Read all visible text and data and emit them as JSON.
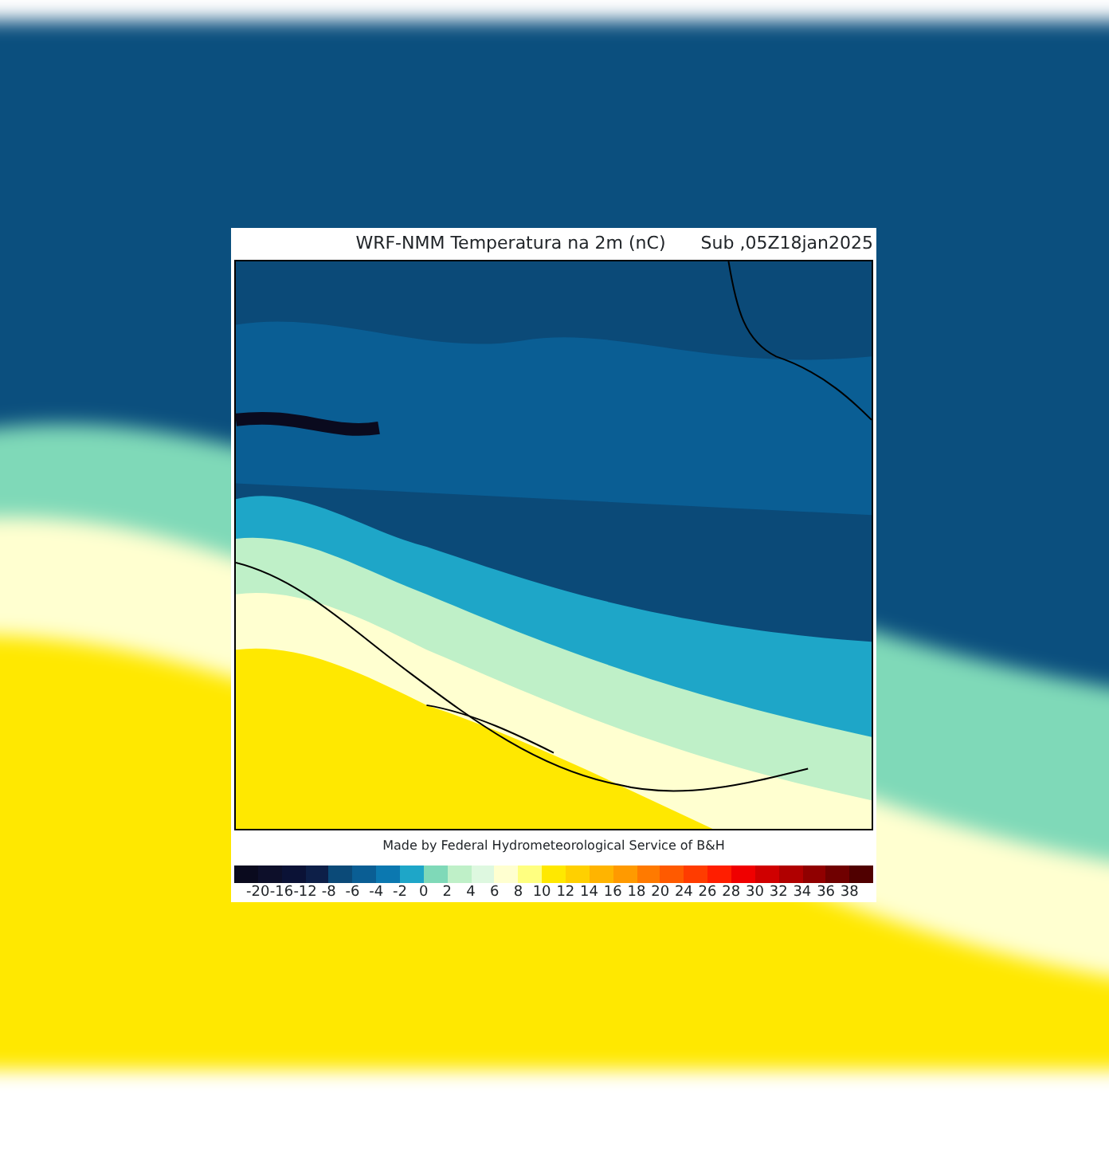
{
  "title": "WRF-NMM Temperatura na 2m (nC)",
  "valid_time": "Sub ,05Z18jan2025",
  "credit": "Made by Federal Hydrometeorological Service of B&H",
  "legend": {
    "bins": [
      {
        "color": "#0a0a1e"
      },
      {
        "color": "#0d0f2a"
      },
      {
        "color": "#0b1236"
      },
      {
        "color": "#0d1f48"
      },
      {
        "color": "#0b4a78"
      },
      {
        "color": "#0a5e94"
      },
      {
        "color": "#0b78b0"
      },
      {
        "color": "#1ea6c8"
      },
      {
        "color": "#7fd9b8"
      },
      {
        "color": "#bff0c8"
      },
      {
        "color": "#def8e0"
      },
      {
        "color": "#ffffd0"
      },
      {
        "color": "#ffff80"
      },
      {
        "color": "#ffe800"
      },
      {
        "color": "#ffd000"
      },
      {
        "color": "#ffb400"
      },
      {
        "color": "#ff9a00"
      },
      {
        "color": "#ff7a00"
      },
      {
        "color": "#ff5a00"
      },
      {
        "color": "#ff3c00"
      },
      {
        "color": "#ff1e00"
      },
      {
        "color": "#f00000"
      },
      {
        "color": "#d00000"
      },
      {
        "color": "#b00000"
      },
      {
        "color": "#900000"
      },
      {
        "color": "#700000"
      },
      {
        "color": "#500000"
      }
    ],
    "ticks": [
      "-20",
      "-16",
      "-12",
      "-8",
      "-6",
      "-4",
      "-2",
      "0",
      "2",
      "4",
      "6",
      "8",
      "10",
      "12",
      "14",
      "16",
      "18",
      "20",
      "24",
      "26",
      "28",
      "30",
      "32",
      "34",
      "36",
      "38"
    ]
  }
}
